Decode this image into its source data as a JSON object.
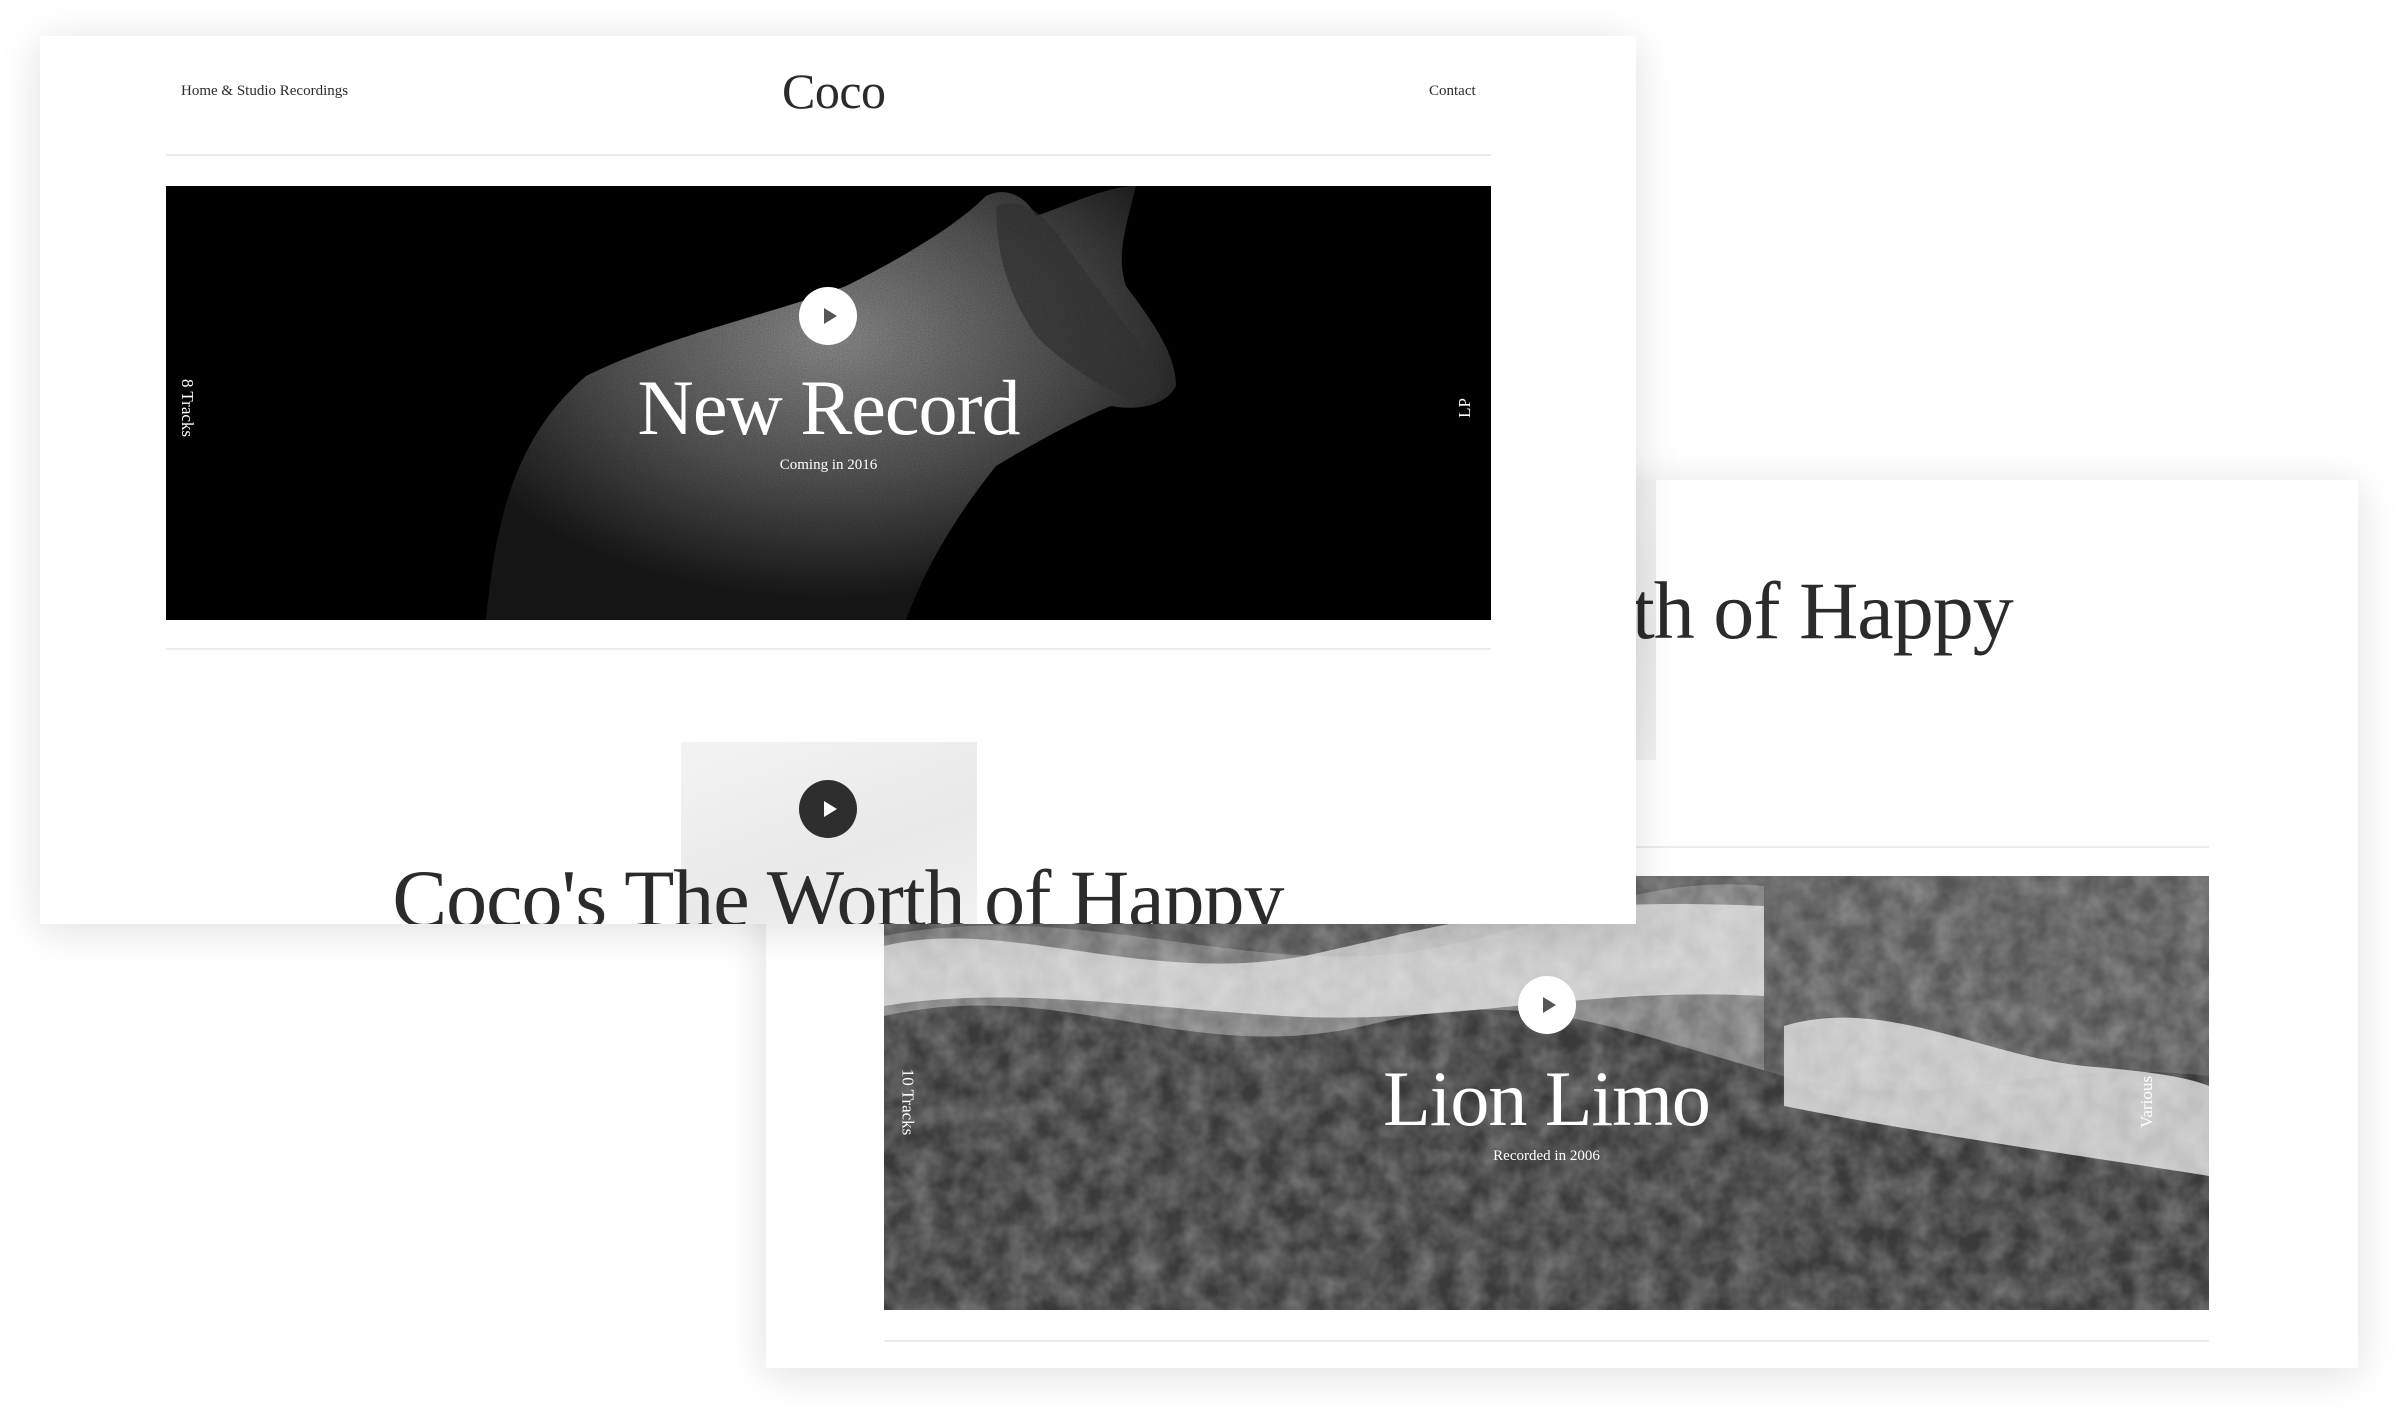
{
  "site": {
    "logo": "Coco",
    "nav_left": "Home & Studio Recordings",
    "nav_right": "Contact"
  },
  "featured": {
    "title": "New Record",
    "subtitle": "Coming in 2016",
    "tracks": "8 Tracks",
    "format": "LP",
    "play_icon": "play-icon"
  },
  "second_album": {
    "title": "Coco's The Worth of Happy",
    "title_fragment": "th of Happy",
    "play_icon": "play-icon"
  },
  "third_album": {
    "title": "Lion Limo",
    "subtitle": "Recorded in 2006",
    "tracks": "10 Tracks",
    "format": "Various",
    "play_icon": "play-icon"
  },
  "colors": {
    "text": "#2b2b2b",
    "background": "#ffffff",
    "hero_dark": "#000000"
  }
}
